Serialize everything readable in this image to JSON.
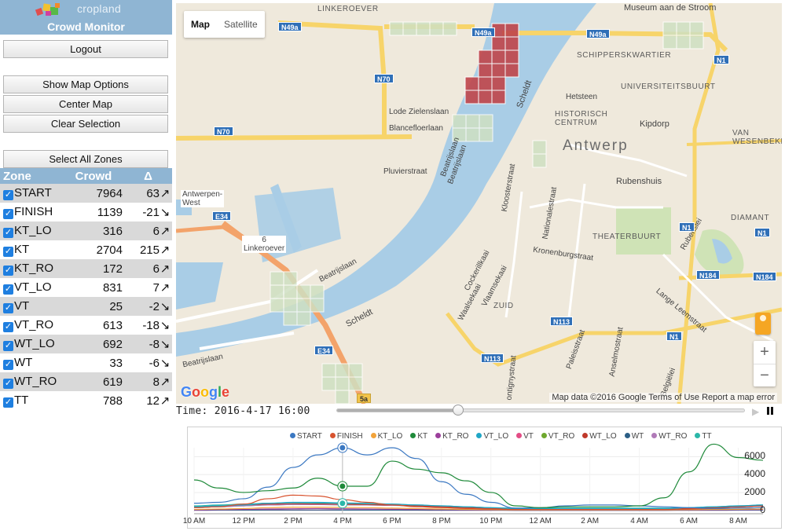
{
  "brand": {
    "logo_text": "cropland",
    "app_title": "Crowd Monitor"
  },
  "buttons": {
    "logout": "Logout",
    "show_map_options": "Show Map Options",
    "center_map": "Center Map",
    "clear_selection": "Clear Selection",
    "select_all_zones": "Select All Zones"
  },
  "zone_table": {
    "headers": [
      "Zone",
      "Crowd",
      "Δ"
    ],
    "rows": [
      {
        "zone": "START",
        "crowd": "7964",
        "delta": "63",
        "trend": "up"
      },
      {
        "zone": "FINISH",
        "crowd": "1139",
        "delta": "-21",
        "trend": "down"
      },
      {
        "zone": "KT_LO",
        "crowd": "316",
        "delta": "6",
        "trend": "up"
      },
      {
        "zone": "KT",
        "crowd": "2704",
        "delta": "215",
        "trend": "up"
      },
      {
        "zone": "KT_RO",
        "crowd": "172",
        "delta": "6",
        "trend": "up"
      },
      {
        "zone": "VT_LO",
        "crowd": "831",
        "delta": "7",
        "trend": "up"
      },
      {
        "zone": "VT",
        "crowd": "25",
        "delta": "-2",
        "trend": "down"
      },
      {
        "zone": "VT_RO",
        "crowd": "613",
        "delta": "-18",
        "trend": "down"
      },
      {
        "zone": "WT_LO",
        "crowd": "692",
        "delta": "-8",
        "trend": "down"
      },
      {
        "zone": "WT",
        "crowd": "33",
        "delta": "-6",
        "trend": "down"
      },
      {
        "zone": "WT_RO",
        "crowd": "619",
        "delta": "8",
        "trend": "up"
      },
      {
        "zone": "TT",
        "crowd": "788",
        "delta": "12",
        "trend": "up"
      }
    ],
    "trend_glyphs": {
      "up": "↗",
      "down": "↘"
    }
  },
  "map": {
    "map_type": {
      "map": "Map",
      "satellite": "Satellite"
    },
    "labels": {
      "linkeroever": "LINKEROEVER",
      "museum": "Museum aan de Stroom",
      "schipperskwartier": "SCHIPPERSKWARTIER",
      "universiteitsbuurt": "UNIVERSITEITSBUURT",
      "hetsteen": "Hetsteen",
      "historisch_centrum": "HISTORISCH CENTRUM",
      "antwerp": "Antwerp",
      "kipdorp": "Kipdorp",
      "van_wesenbeke": "VAN WESENBEKE",
      "rubenshuis": "Rubenshuis",
      "diamant": "DIAMANT",
      "theaterbuurt": "THEATERBUURT",
      "zuid": "ZUID",
      "lode": "Lode Zielenslaan",
      "blancefloer": "Blancefloerlaan",
      "pluvier": "Pluvierstraat",
      "beatrijslaan_a": "Beatrijslaan",
      "beatrijslaan_b": "Beatrijslaan",
      "beatrijslaan_c": "Beatrijslaan",
      "beatrijslaan_d": "Beatrijslaan",
      "scheldt_a": "Scheldt",
      "scheldt_b": "Scheldt",
      "antwerpen_west": "Antwerpen-\nWest",
      "linkeroever_exit": "6\nLinkeroever",
      "kloosterstraat": "Kloosterstraat",
      "nationalestraat": "Nationalestraat",
      "kronenburgstraat": "Kronenburgstraat",
      "cockerillkaai": "Cockerillkaai",
      "vlaamsekaai": "Vlaamsekaai",
      "waalsekaai": "Waalsekaai",
      "anselmostraat": "Anselmostraat",
      "paleisstraat": "Paleisstraat",
      "lange_leemstraat": "Lange Leemstraat",
      "rubenslei": "Rubenslei",
      "belgielei": "Belgiëlei",
      "montignystraat": "ontignystraat"
    },
    "shields": {
      "n49a_1": "N49a",
      "n49a_2": "N49a",
      "n49a_3": "N49a",
      "n1_1": "N1",
      "n1_2": "N1",
      "n1_3": "N1",
      "n1_4": "N1",
      "n70_1": "N70",
      "n70_2": "N70",
      "e34_1": "E34",
      "e34_2": "E34",
      "n184_1": "N184",
      "n184_2": "N184",
      "n113_1": "N113",
      "n113_2": "N113",
      "r5a": "5a"
    },
    "google_logo": "Google",
    "attribution": "Map data ©2016 Google   Terms of Use   Report a map error",
    "zoom_in": "+",
    "zoom_out": "−"
  },
  "timebar": {
    "time_label": "Time: 2016-4-17 16:00",
    "position": 0.296
  },
  "chart_data": {
    "type": "line",
    "x_ticks": [
      "10 AM",
      "12 PM",
      "2 PM",
      "4 PM",
      "6 PM",
      "8 PM",
      "10 PM",
      "12 AM",
      "2 AM",
      "4 AM",
      "6 AM",
      "8 AM"
    ],
    "x": [
      10,
      11,
      12,
      13,
      14,
      15,
      16,
      17,
      18,
      19,
      20,
      21,
      22,
      23,
      24,
      25,
      26,
      27,
      28,
      29,
      30,
      31,
      32,
      33
    ],
    "ylim": [
      -200,
      7000
    ],
    "y_ticks": [
      "6000",
      "4000",
      "2000",
      "0"
    ],
    "y_tick_values": [
      6000,
      4000,
      2000,
      0
    ],
    "cursor_x": 16,
    "grid": true,
    "legend_position": "top",
    "series": [
      {
        "name": "START",
        "color": "#3b78c2",
        "values": [
          800,
          900,
          1300,
          2600,
          4800,
          6200,
          7000,
          6200,
          7000,
          5800,
          3200,
          1800,
          900,
          250,
          300,
          500,
          600,
          600,
          500,
          400,
          300,
          200,
          250,
          300
        ]
      },
      {
        "name": "FINISH",
        "color": "#d8532f",
        "values": [
          300,
          400,
          700,
          1300,
          1700,
          1600,
          1200,
          900,
          600,
          400,
          300,
          200,
          150,
          100,
          100,
          100,
          100,
          100,
          100,
          100,
          150,
          200,
          250,
          300
        ]
      },
      {
        "name": "KT_LO",
        "color": "#f2a33a",
        "values": [
          100,
          150,
          200,
          300,
          350,
          350,
          320,
          300,
          250,
          200,
          150,
          100,
          80,
          60,
          60,
          60,
          60,
          60,
          60,
          60,
          80,
          100,
          120,
          150
        ]
      },
      {
        "name": "KT",
        "color": "#1f8a3a",
        "values": [
          3400,
          2500,
          2000,
          2200,
          2500,
          3600,
          2700,
          2700,
          5500,
          4600,
          4200,
          3300,
          2000,
          500,
          300,
          400,
          400,
          400,
          500,
          1400,
          4300,
          7400,
          5900,
          5600
        ]
      },
      {
        "name": "KT_RO",
        "color": "#9b3f9b",
        "values": [
          50,
          80,
          100,
          150,
          180,
          200,
          170,
          150,
          120,
          100,
          80,
          60,
          50,
          40,
          40,
          40,
          40,
          40,
          40,
          40,
          50,
          60,
          70,
          80
        ]
      },
      {
        "name": "VT_LO",
        "color": "#20a6c6",
        "values": [
          400,
          500,
          600,
          800,
          900,
          900,
          830,
          800,
          700,
          600,
          500,
          400,
          300,
          200,
          200,
          200,
          200,
          200,
          200,
          200,
          300,
          400,
          500,
          600
        ]
      },
      {
        "name": "VT",
        "color": "#e34d86",
        "values": [
          20,
          25,
          30,
          30,
          30,
          30,
          25,
          25,
          25,
          20,
          20,
          20,
          15,
          10,
          10,
          10,
          10,
          10,
          10,
          10,
          15,
          20,
          25,
          25
        ]
      },
      {
        "name": "VT_RO",
        "color": "#6fa82e",
        "values": [
          300,
          400,
          500,
          600,
          650,
          650,
          610,
          600,
          550,
          500,
          400,
          300,
          250,
          200,
          200,
          200,
          200,
          200,
          200,
          200,
          250,
          300,
          400,
          500
        ]
      },
      {
        "name": "WT_LO",
        "color": "#c0392b",
        "values": [
          400,
          500,
          600,
          700,
          750,
          720,
          690,
          650,
          600,
          500,
          400,
          300,
          250,
          200,
          200,
          200,
          200,
          200,
          200,
          200,
          250,
          300,
          400,
          500
        ]
      },
      {
        "name": "WT",
        "color": "#2c5f86",
        "values": [
          20,
          25,
          30,
          35,
          35,
          35,
          33,
          30,
          30,
          25,
          20,
          20,
          15,
          10,
          10,
          10,
          10,
          10,
          10,
          10,
          15,
          20,
          25,
          30
        ]
      },
      {
        "name": "WT_RO",
        "color": "#b07ab8",
        "values": [
          300,
          400,
          500,
          600,
          650,
          640,
          620,
          600,
          550,
          500,
          400,
          300,
          250,
          200,
          200,
          200,
          200,
          200,
          200,
          200,
          250,
          300,
          400,
          500
        ]
      },
      {
        "name": "TT",
        "color": "#2bb7a8",
        "values": [
          500,
          600,
          700,
          800,
          850,
          820,
          790,
          750,
          700,
          600,
          500,
          400,
          300,
          250,
          250,
          250,
          250,
          250,
          250,
          250,
          300,
          400,
          500,
          600
        ]
      }
    ]
  }
}
